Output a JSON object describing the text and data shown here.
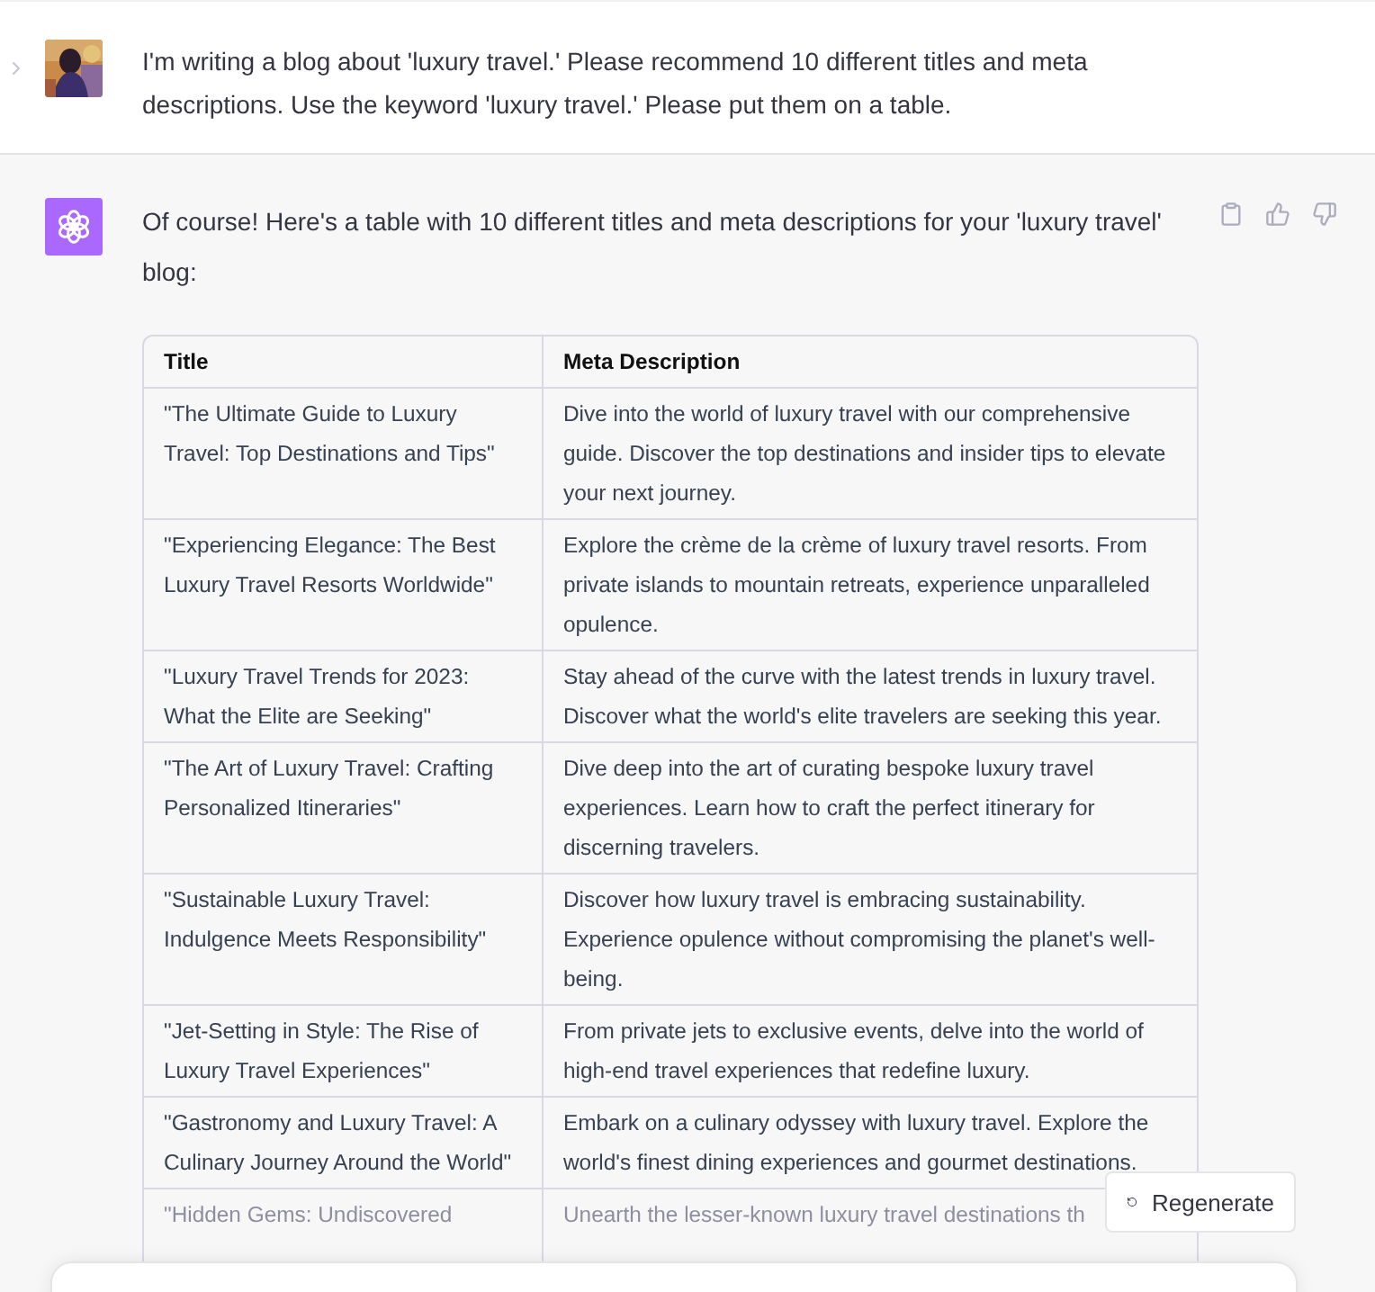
{
  "user_message": {
    "text": "I'm writing a blog about 'luxury travel.' Please recommend 10 different titles and meta descriptions. Use the keyword 'luxury travel.' Please put them on a table."
  },
  "assistant_message": {
    "intro": "Of course! Here's a table with 10 different titles and meta descriptions for your 'luxury travel' blog:",
    "table": {
      "columns": [
        "Title",
        "Meta Description"
      ],
      "rows": [
        {
          "title": "\"The Ultimate Guide to Luxury Travel: Top Destinations and Tips\"",
          "description": "Dive into the world of luxury travel with our comprehensive guide. Discover the top destinations and insider tips to elevate your next journey.",
          "faded": false
        },
        {
          "title": "\"Experiencing Elegance: The Best Luxury Travel Resorts Worldwide\"",
          "description": "Explore the crème de la crème of luxury travel resorts. From private islands to mountain retreats, experience unparalleled opulence.",
          "faded": false
        },
        {
          "title": "\"Luxury Travel Trends for 2023: What the Elite are Seeking\"",
          "description": "Stay ahead of the curve with the latest trends in luxury travel. Discover what the world's elite travelers are seeking this year.",
          "faded": false
        },
        {
          "title": "\"The Art of Luxury Travel: Crafting Personalized Itineraries\"",
          "description": "Dive deep into the art of curating bespoke luxury travel experiences. Learn how to craft the perfect itinerary for discerning travelers.",
          "faded": false
        },
        {
          "title": "\"Sustainable Luxury Travel: Indulgence Meets Responsibility\"",
          "description": "Discover how luxury travel is embracing sustainability. Experience opulence without compromising the planet's well-being.",
          "faded": false
        },
        {
          "title": "\"Jet-Setting in Style: The Rise of Luxury Travel Experiences\"",
          "description": "From private jets to exclusive events, delve into the world of high-end travel experiences that redefine luxury.",
          "faded": false
        },
        {
          "title": "\"Gastronomy and Luxury Travel: A Culinary Journey Around the World\"",
          "description": "Embark on a culinary odyssey with luxury travel. Explore the world's finest dining experiences and gourmet destinations.",
          "faded": false
        },
        {
          "title": "\"Hidden Gems: Undiscovered",
          "description": "Unearth the lesser-known luxury travel destinations th",
          "faded": true
        }
      ]
    }
  },
  "regenerate_button": {
    "label": "Regenerate"
  }
}
